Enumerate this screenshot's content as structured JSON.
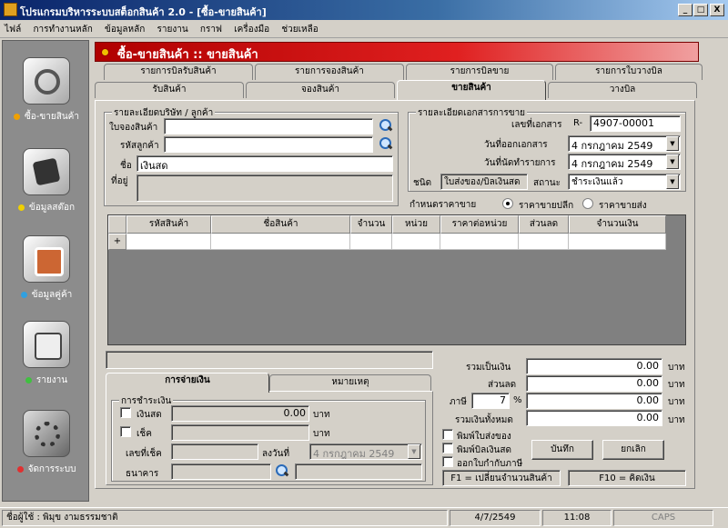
{
  "window": {
    "title": "โปรแกรมบริหารระบบสต็อกสินค้า 2.0  - [ซื้อ-ขายสินค้า]",
    "min": "_",
    "max": "□",
    "close": "X"
  },
  "menu": [
    "ไฟล์",
    "การทำงานหลัก",
    "ข้อมูลหลัก",
    "รายงาน",
    "กราฟ",
    "เครื่องมือ",
    "ช่วยเหลือ"
  ],
  "sidebar": [
    {
      "label": "ซื้อ-ขายสินค้า",
      "dot": "#f0a000"
    },
    {
      "label": "ข้อมูลสต๊อก",
      "dot": "#f0d000"
    },
    {
      "label": "ข้อมูลคู่ค้า",
      "dot": "#30a0e0"
    },
    {
      "label": "รายงาน",
      "dot": "#40c040"
    },
    {
      "label": "จัดการระบบ",
      "dot": "#e03030"
    }
  ],
  "header": {
    "title": "ซื้อ-ขายสินค้า :: ขายสินค้า"
  },
  "tabs_back": [
    "รายการบิลรับสินค้า",
    "รายการจองสินค้า",
    "รายการบิลขาย",
    "รายการใบวางบิล"
  ],
  "tabs_front": [
    "รับสินค้า",
    "จองสินค้า",
    "ขายสินค้า",
    "วางบิล"
  ],
  "customer": {
    "group_title": "รายละเอียดบริษัท / ลูกค้า",
    "reserve_label": "ใบจองสินค้า",
    "reserve_value": "",
    "code_label": "รหัสลูกค้า",
    "code_value": "",
    "name_label": "ชื่อ",
    "name_value": "เงินสด",
    "address_label": "ที่อยู่",
    "address_value": ""
  },
  "document": {
    "group_title": "รายละเอียดเอกสารการขาย",
    "docno_label": "เลขที่เอกสาร",
    "docno_prefix": "R-",
    "docno_value": "4907-00001",
    "docdate_label": "วันที่ออกเอกสาร",
    "docdate_value": "4   กรกฎาคม   2549",
    "duedate_label": "วันที่นัดทำรายการ",
    "duedate_value": "4   กรกฎาคม   2549",
    "type_label": "ชนิด",
    "type_value": "ใบส่งของ/บิลเงินสด",
    "status_label": "สถานะ",
    "status_value": "ชำระเงินแล้ว",
    "price_label": "กำหนดราคาขาย",
    "price_retail": "ราคาขายปลีก",
    "price_wholesale": "ราคาขายส่ง"
  },
  "grid": {
    "columns": [
      "รหัสสินค้า",
      "ชื่อสินค้า",
      "จำนวน",
      "หน่วย",
      "ราคาต่อหน่วย",
      "ส่วนลด",
      "จำนวนเงิน"
    ],
    "new_row_marker": "+"
  },
  "payment_tabs": [
    "การจ่ายเงิน",
    "หมายเหตุ"
  ],
  "payment": {
    "group_title": "การชำระเงิน",
    "cash_label": "เงินสด",
    "cash_value": "0.00",
    "cash_unit": "บาท",
    "cheque_label": "เช็ค",
    "cheque_value": "",
    "cheque_unit": "บาท",
    "chequeno_label": "เลขที่เช็ค",
    "chequeno_value": "",
    "chequedate_label": "ลงวันที่",
    "chequedate_value": "4   กรกฎาคม   2549",
    "bank_label": "ธนาคาร",
    "bank_value": ""
  },
  "totals": {
    "subtotal_label": "รวมเป็นเงิน",
    "subtotal": "0.00",
    "discount_label": "ส่วนลด",
    "discount": "0.00",
    "tax_label": "ภาษี",
    "tax_rate": "7",
    "tax_pct": "%",
    "tax": "0.00",
    "grand_label": "รวมเงินทั้งหมด",
    "grand": "0.00",
    "unit": "บาท"
  },
  "options": {
    "print_delivery": "พิมพ์ใบส่งของ",
    "print_cash": "พิมพ์บิลเงินสด",
    "print_tax": "ออกใบกำกับภาษี"
  },
  "buttons": {
    "save": "บันทึก",
    "cancel": "ยกเลิก"
  },
  "hints": {
    "f1": "F1 = เปลี่ยนจำนวนสินค้า",
    "f10": "F10 = คิดเงิน"
  },
  "status": {
    "user": "ชื่อผู้ใช้ : พิมุข งามธรรมชาติ",
    "date": "4/7/2549",
    "time": "11:08",
    "caps": "CAPS"
  }
}
